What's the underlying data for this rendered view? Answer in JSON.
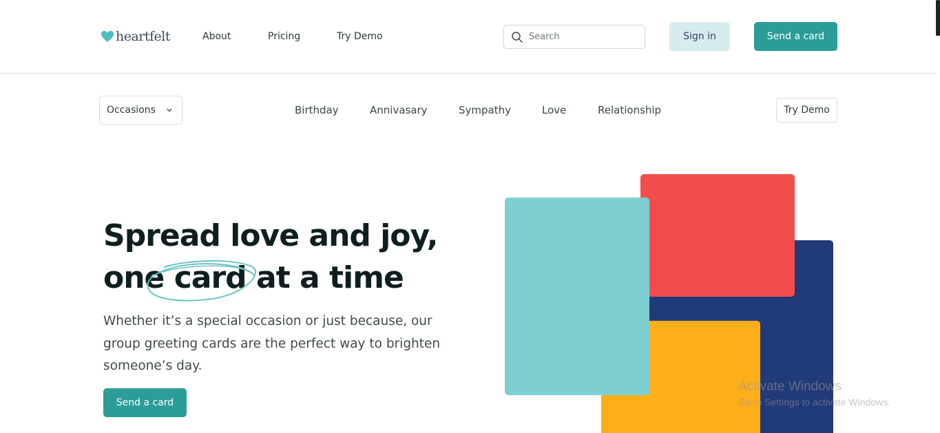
{
  "header": {
    "logo_text": "heartfelt",
    "nav": {
      "about": "About",
      "pricing": "Pricing",
      "try_demo": "Try Demo"
    },
    "search": {
      "placeholder": "Search",
      "value": ""
    },
    "sign_in_label": "Sign in",
    "send_card_label": "Send a card"
  },
  "subnav": {
    "occasions_label": "Occasions",
    "categories": {
      "birthday": "Birthday",
      "anniversary": "Annivasary",
      "sympathy": "Sympathy",
      "love": "Love",
      "relationship": "Relationship"
    },
    "try_demo_label": "Try Demo"
  },
  "hero": {
    "title_line1": "Spread love and joy,",
    "title_line2": "one card at a time",
    "subtitle": "Whether it’s a special occasion or just because, our group greeting cards are the perfect way to brighten someone’s day.",
    "cta_label": "Send a card"
  },
  "watermark": {
    "title": "Activate Windows",
    "subtitle": "Go to Settings to activate Windows."
  },
  "colors": {
    "brand_teal": "#2a9d96",
    "signin_bg": "#d6ecee",
    "card_teal": "#7dcfd2",
    "card_red": "#f24c4c",
    "card_navy": "#213a78",
    "card_yellow": "#fdae1b"
  },
  "icons": {
    "logo": "heart-icon",
    "search": "search-icon",
    "occasions": "chevron-down-icon"
  }
}
